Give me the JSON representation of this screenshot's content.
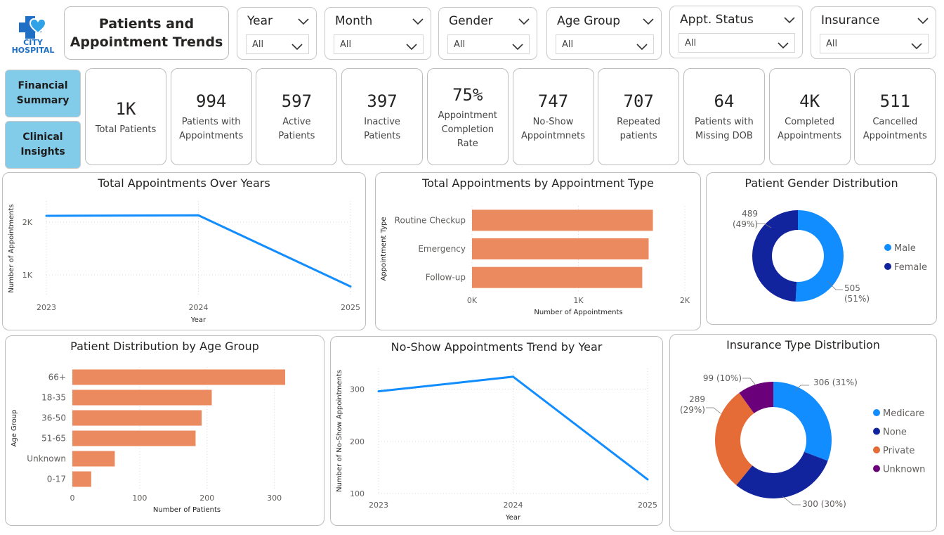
{
  "logo": {
    "line1": "CITY",
    "line2": "HOSPITAL",
    "icon": "medical-cross-heart-icon"
  },
  "page_title": {
    "line1": "Patients and",
    "line2": "Appointment Trends"
  },
  "filters": [
    {
      "label": "Year",
      "value": "All"
    },
    {
      "label": "Month",
      "value": "All"
    },
    {
      "label": "Gender",
      "value": "All"
    },
    {
      "label": "Age Group",
      "value": "All"
    },
    {
      "label": "Appt. Status",
      "value": "All"
    },
    {
      "label": "Insurance",
      "value": "All"
    }
  ],
  "nav": {
    "financial": {
      "line1": "Financial",
      "line2": "Summary"
    },
    "clinical": {
      "line1": "Clinical",
      "line2": "Insights"
    }
  },
  "kpis": [
    {
      "value": "1K",
      "l1": "Total Patients",
      "l2": "",
      "l3": ""
    },
    {
      "value": "994",
      "l1": "Patients with",
      "l2": "Appointments",
      "l3": ""
    },
    {
      "value": "597",
      "l1": "Active",
      "l2": "Patients",
      "l3": ""
    },
    {
      "value": "397",
      "l1": "Inactive",
      "l2": "Patients",
      "l3": ""
    },
    {
      "value": "75%",
      "l1": "Appointment",
      "l2": "Completion",
      "l3": "Rate"
    },
    {
      "value": "747",
      "l1": "No-Show",
      "l2": "Appointmnets",
      "l3": ""
    },
    {
      "value": "707",
      "l1": "Repeated",
      "l2": "patients",
      "l3": ""
    },
    {
      "value": "64",
      "l1": "Patients with",
      "l2": "Missing DOB",
      "l3": ""
    },
    {
      "value": "4K",
      "l1": "Completed",
      "l2": "Appointments",
      "l3": ""
    },
    {
      "value": "511",
      "l1": "Cancelled",
      "l2": "Appointments",
      "l3": ""
    }
  ],
  "colors": {
    "line": "#118dff",
    "bar": "#eb895f",
    "male": "#118dff",
    "female": "#12239e",
    "medicare": "#118dff",
    "none": "#12239e",
    "private": "#e66c37",
    "unknown": "#6b007b",
    "nav": "#82cce9"
  },
  "chart_data": [
    {
      "id": "appointments_over_years",
      "type": "line",
      "title": "Total Appointments Over Years",
      "xlabel": "Year",
      "ylabel": "Number of Appointments",
      "x": [
        "2023",
        "2024",
        "2025"
      ],
      "values": [
        2120,
        2130,
        780
      ],
      "ylim": [
        600,
        2400
      ],
      "yticks": [
        1000,
        2000
      ],
      "ytick_labels": [
        "1K",
        "2K"
      ],
      "grid": true
    },
    {
      "id": "appointments_by_type",
      "type": "bar",
      "orientation": "horizontal",
      "title": "Total Appointments by Appointment Type",
      "xlabel": "Number of Appointments",
      "ylabel": "Appointment Type",
      "categories": [
        "Routine Checkup",
        "Emergency",
        "Follow-up"
      ],
      "values": [
        1700,
        1660,
        1600
      ],
      "xlim": [
        0,
        2000
      ],
      "xticks": [
        0,
        1000,
        2000
      ],
      "xtick_labels": [
        "0K",
        "1K",
        "2K"
      ],
      "grid": true
    },
    {
      "id": "gender_distribution",
      "type": "pie",
      "donut": true,
      "title": "Patient Gender Distribution",
      "categories": [
        "Male",
        "Female"
      ],
      "values": [
        505,
        489
      ],
      "labels": [
        "505 (51%)",
        "489 (49%)"
      ],
      "legend": "right"
    },
    {
      "id": "age_group_distribution",
      "type": "bar",
      "orientation": "horizontal",
      "title": "Patient Distribution by Age Group",
      "xlabel": "Number of Patients",
      "ylabel": "Age Group",
      "categories": [
        "66+",
        "18-35",
        "36-50",
        "51-65",
        "Unknown",
        "0-17"
      ],
      "values": [
        316,
        207,
        192,
        183,
        63,
        28
      ],
      "xlim": [
        0,
        340
      ],
      "xticks": [
        0,
        100,
        200,
        300
      ],
      "xtick_labels": [
        "0",
        "100",
        "200",
        "300"
      ],
      "grid": true
    },
    {
      "id": "noshow_trend",
      "type": "line",
      "title": "No-Show Appointments Trend by Year",
      "xlabel": "Year",
      "ylabel": "Number of No-Show Appointments",
      "x": [
        "2023",
        "2024",
        "2025"
      ],
      "values": [
        296,
        324,
        127
      ],
      "ylim": [
        100,
        340
      ],
      "yticks": [
        100,
        200,
        300
      ],
      "ytick_labels": [
        "100",
        "200",
        "300"
      ],
      "grid": true
    },
    {
      "id": "insurance_distribution",
      "type": "pie",
      "donut": true,
      "title": "Insurance Type Distribution",
      "categories": [
        "Medicare",
        "None",
        "Private",
        "Unknown"
      ],
      "values": [
        306,
        300,
        289,
        99
      ],
      "labels": [
        "306 (31%)",
        "300 (30%)",
        "289 (29%)",
        "99 (10%)"
      ],
      "legend": "right"
    }
  ]
}
